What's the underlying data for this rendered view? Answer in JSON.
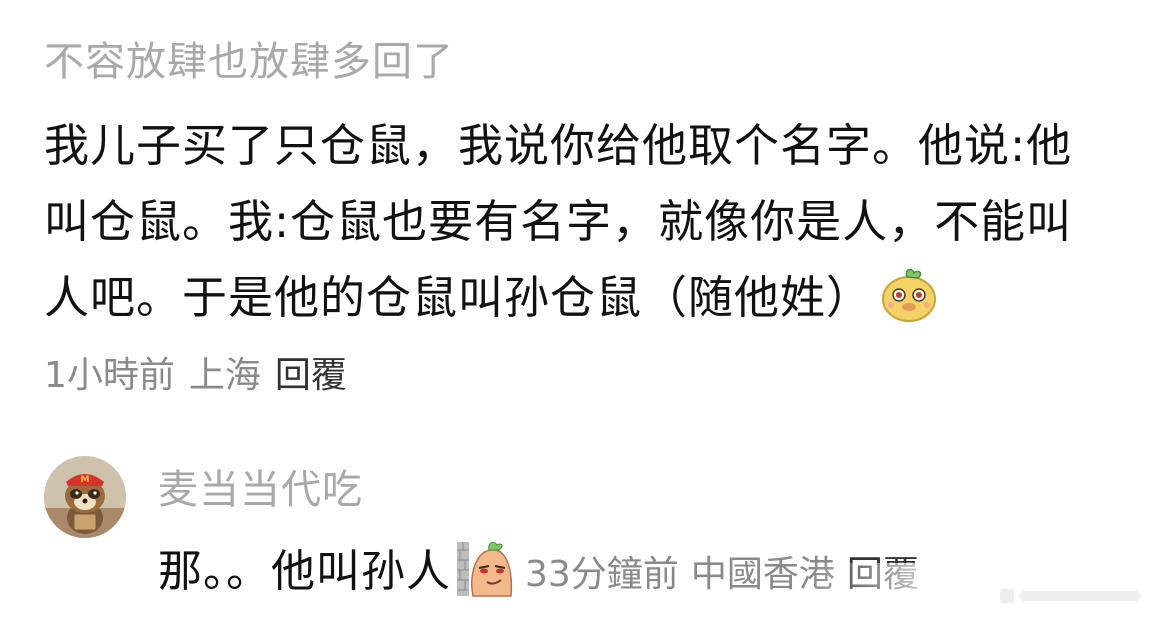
{
  "comment": {
    "username": "不容放肆也放肆多回了",
    "lines": [
      "我儿子买了只仓鼠，我说你给他取个名字。他说:他",
      "叫仓鼠。我:仓鼠也要有名字，就像你是人，不能叫",
      "人吧。于是他的仓鼠叫孙仓鼠（随他姓）"
    ],
    "emoji_icon": "yellow-face-emoji-icon",
    "time": "1小時前",
    "location": "上海",
    "reply_label": "回覆"
  },
  "reply": {
    "avatar_icon": "raccoon-mcdonalds-avatar-icon",
    "username": "麦当当代吃",
    "text": "那。。他叫孙人",
    "sticker_icon": "smirking-bean-sticker-icon",
    "time": "33分鐘前",
    "location": "中國香港",
    "reply_label": "回覆"
  },
  "colors": {
    "username": "#a9a9a9",
    "body_text": "#111111",
    "meta_text": "#8a8a8a",
    "background": "#ffffff"
  }
}
